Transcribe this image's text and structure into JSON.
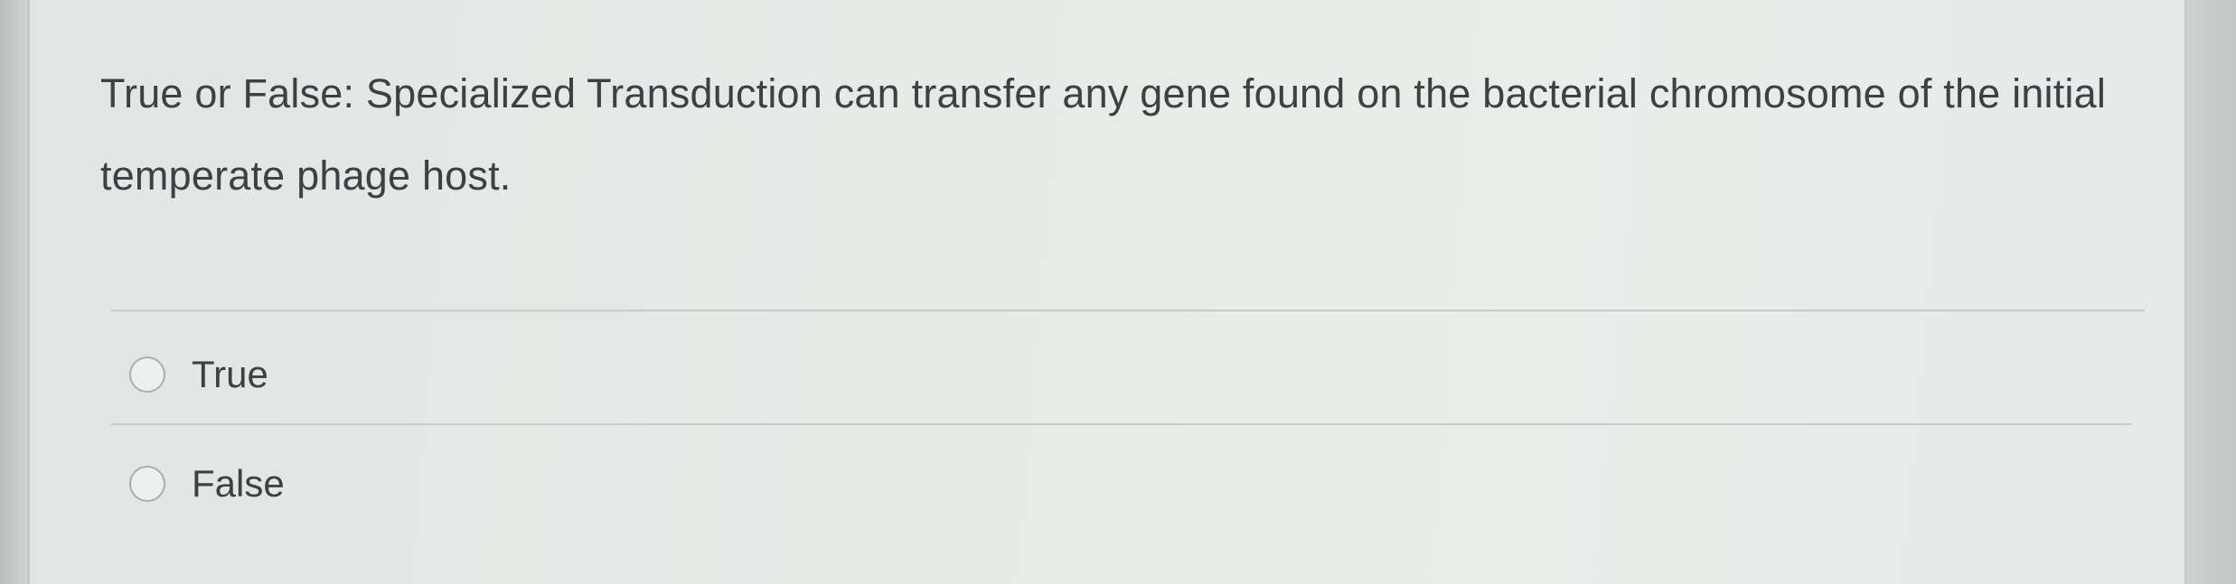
{
  "question": {
    "text": "True or False: Specialized Transduction can transfer any gene found on the bacterial chromosome of the initial temperate phage host."
  },
  "options": [
    {
      "label": "True",
      "selected": false
    },
    {
      "label": "False",
      "selected": false
    }
  ]
}
